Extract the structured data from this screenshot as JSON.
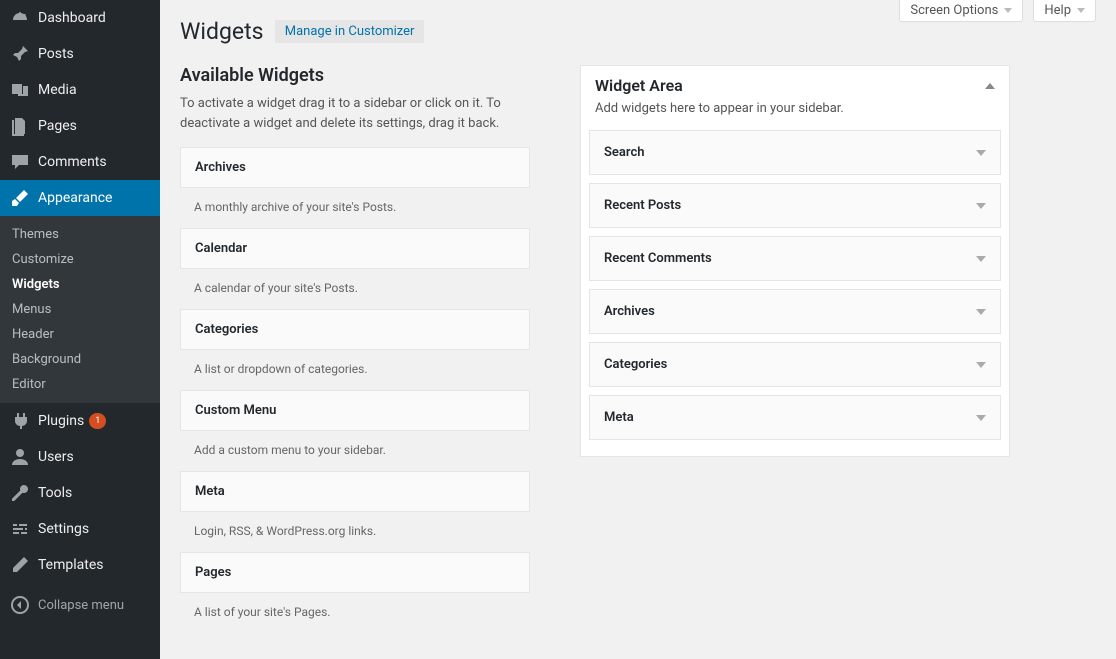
{
  "topbar": {
    "screen_options": "Screen Options",
    "help": "Help"
  },
  "page": {
    "title": "Widgets",
    "manage_label": "Manage in Customizer"
  },
  "sidebar": {
    "items": [
      {
        "label": "Dashboard",
        "icon": "dashboard"
      },
      {
        "label": "Posts",
        "icon": "pin"
      },
      {
        "label": "Media",
        "icon": "media"
      },
      {
        "label": "Pages",
        "icon": "pages"
      },
      {
        "label": "Comments",
        "icon": "comment"
      },
      {
        "label": "Appearance",
        "icon": "brush",
        "active": true
      },
      {
        "label": "Plugins",
        "icon": "plug",
        "badge": "1"
      },
      {
        "label": "Users",
        "icon": "user"
      },
      {
        "label": "Tools",
        "icon": "wrench"
      },
      {
        "label": "Settings",
        "icon": "sliders"
      },
      {
        "label": "Templates",
        "icon": "pencil"
      }
    ],
    "submenu": [
      {
        "label": "Themes"
      },
      {
        "label": "Customize"
      },
      {
        "label": "Widgets",
        "current": true
      },
      {
        "label": "Menus"
      },
      {
        "label": "Header"
      },
      {
        "label": "Background"
      },
      {
        "label": "Editor"
      }
    ],
    "collapse_label": "Collapse menu"
  },
  "available": {
    "title": "Available Widgets",
    "desc": "To activate a widget drag it to a sidebar or click on it. To deactivate a widget and delete its settings, drag it back.",
    "widgets": [
      {
        "name": "Archives",
        "desc": "A monthly archive of your site's Posts."
      },
      {
        "name": "Calendar",
        "desc": "A calendar of your site's Posts."
      },
      {
        "name": "Categories",
        "desc": "A list or dropdown of categories."
      },
      {
        "name": "Custom Menu",
        "desc": "Add a custom menu to your sidebar."
      },
      {
        "name": "Meta",
        "desc": "Login, RSS, & WordPress.org links."
      },
      {
        "name": "Pages",
        "desc": "A list of your site's Pages."
      }
    ]
  },
  "area": {
    "title": "Widget Area",
    "desc": "Add widgets here to appear in your sidebar.",
    "widgets": [
      {
        "name": "Search"
      },
      {
        "name": "Recent Posts"
      },
      {
        "name": "Recent Comments"
      },
      {
        "name": "Archives"
      },
      {
        "name": "Categories"
      },
      {
        "name": "Meta"
      }
    ]
  }
}
